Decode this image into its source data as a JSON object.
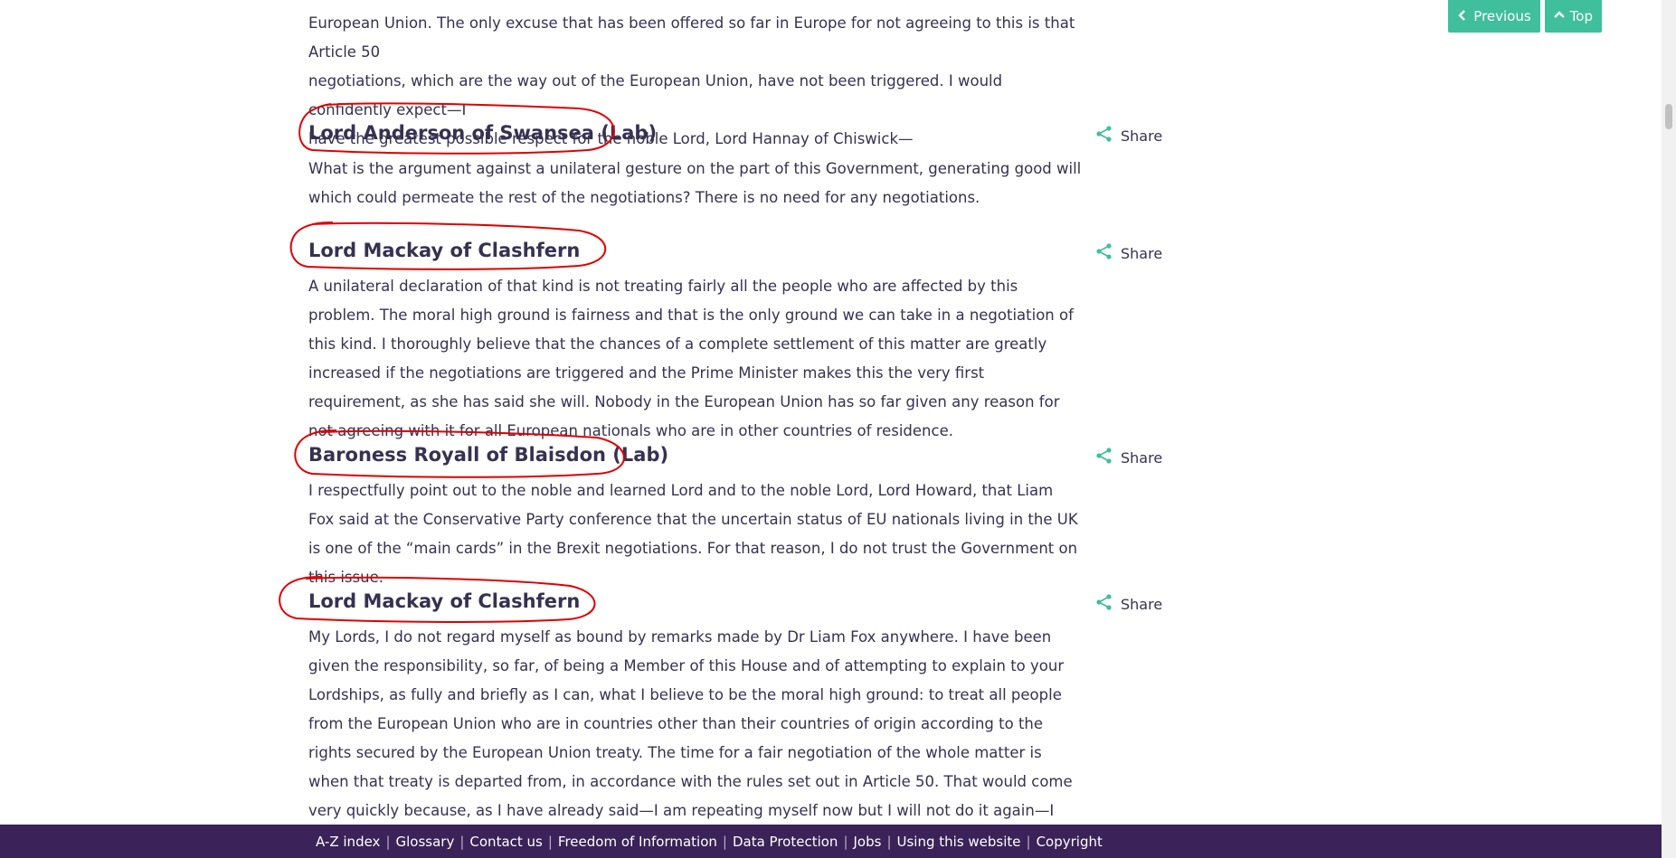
{
  "previous_paragraph": {
    "lines": [
      "European Union. The only excuse that has been offered so far in Europe for not agreeing to this is that Article 50",
      "negotiations, which are the way out of the European Union, have not been triggered. I would confidently expect—I",
      "have the greatest possible respect for the noble Lord, Lord Hannay of Chiswick—"
    ]
  },
  "contributions": [
    {
      "speaker": "Lord Anderson of Swansea (Lab)",
      "share_label": "Share",
      "text": "What is the argument against a unilateral gesture on the part of this Government, generating good will which could permeate the rest of the negotiations? There is no need for any negotiations."
    },
    {
      "speaker": "Lord Mackay of Clashfern",
      "share_label": "Share",
      "text": "A unilateral declaration of that kind is not treating fairly all the people who are affected by this problem. The moral high ground is fairness and that is the only ground we can take in a negotiation of this kind. I thoroughly believe that the chances of a complete settlement of this matter are greatly increased if the negotiations are triggered and the Prime Minister makes this the very first requirement, as she has said she will. Nobody in the European Union has so far given any reason for not agreeing with it for all European nationals who are in other countries of residence."
    },
    {
      "speaker": "Baroness Royall of Blaisdon (Lab)",
      "share_label": "Share",
      "text": "I respectfully point out to the noble and learned Lord and to the noble Lord, Lord Howard, that Liam Fox said at the Conservative Party conference that the uncertain status of EU nationals living in the UK is one of the “main cards” in the Brexit negotiations. For that reason, I do not trust the Government on this issue."
    },
    {
      "speaker": "Lord Mackay of Clashfern",
      "share_label": "Share",
      "text": "My Lords, I do not regard myself as bound by remarks made by Dr Liam Fox anywhere. I have been given the responsibility, so far, of being a Member of this House and of attempting to explain to your Lordships, as fully and briefly as I can, what I believe to be the moral high ground: to treat all people from the European Union who are in countries other than their countries of origin according to the rights secured by the European Union treaty. The time for a fair negotiation of the whole matter is when that treaty is departed from, in accordance with the rules set out in Article 50. That would come very quickly because, as I have already said—I am repeating myself now but I will not do it again—I have heard no argument from Europe against this, except that the negotiations have not been triggered in"
    }
  ],
  "nav_buttons": {
    "previous_label": "Previous",
    "top_label": "Top"
  },
  "footer": {
    "links": [
      "A-Z index",
      "Glossary",
      "Contact us",
      "Freedom of Information",
      "Data Protection",
      "Jobs",
      "Using this website",
      "Copyright"
    ]
  },
  "colors": {
    "text": "#373151",
    "accent_green": "#3fbf9b",
    "footer_bg": "#3b2258",
    "annotation_red": "#e00000"
  },
  "icons": {
    "share": "share-icon",
    "previous": "chevron-left-icon",
    "top": "chevron-up-icon"
  }
}
